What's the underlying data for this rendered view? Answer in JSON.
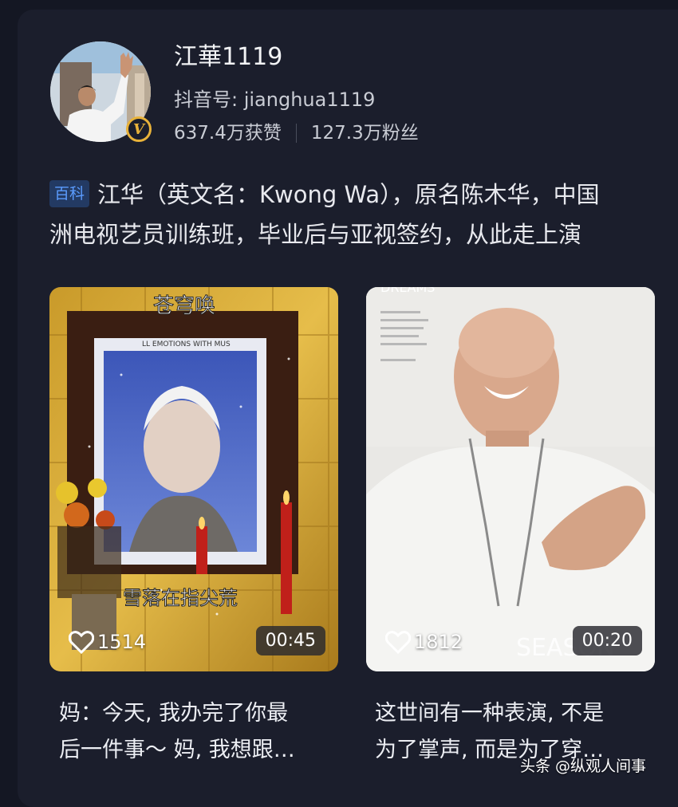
{
  "profile": {
    "name": "江華1119",
    "handle": "抖音号: jianghua1119",
    "likes": "637.4万获赞",
    "followers": "127.3万粉丝",
    "verified_icon": "v-verified-badge"
  },
  "bio": {
    "tag": "百科",
    "line1": "江华（英文名：Kwong Wa），原名陈木华，中国",
    "line2": "洲电视艺员训练班，毕业后与亚视签约，从此走上演"
  },
  "videos": [
    {
      "overlay_top": "苍穹唤",
      "overlay_sub": "LL EMOTIONS WITH MUS",
      "overlay_bottom": "雪落在指尖荒",
      "likes": "1514",
      "duration": "00:45",
      "caption_line1": "妈：今天, 我办完了你最",
      "caption_line2": "后一件事～ 妈, 我想跟…"
    },
    {
      "overlay_top": "DREAMS",
      "overlay_bottom": "SEASON",
      "likes": "1812",
      "duration": "00:20",
      "caption_line1": "这世间有一种表演, 不是",
      "caption_line2": "为了掌声, 而是为了穿…"
    }
  ],
  "watermark": "头条 @纵观人间事",
  "colors": {
    "background": "#141723",
    "card": "#1b1e2c",
    "tag_bg": "#233a63",
    "tag_text": "#5b9cff",
    "verified": "#e8b23a"
  }
}
